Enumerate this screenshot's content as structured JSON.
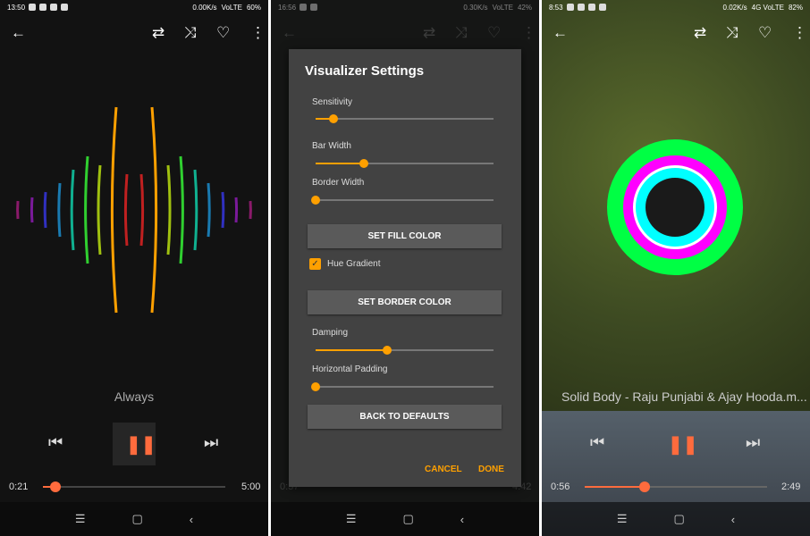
{
  "panels": [
    {
      "status": {
        "time": "13:50",
        "speed": "0.00K/s",
        "network": "VoLTE",
        "battery": "60%"
      },
      "track_title": "Always",
      "elapsed": "0:21",
      "duration": "5:00",
      "progress": 0.07
    },
    {
      "status": {
        "time": "16:56",
        "speed": "0.30K/s",
        "network": "VoLTE",
        "battery": "42%"
      },
      "elapsed": "0:37",
      "duration": "4:42",
      "dialog": {
        "title": "Visualizer Settings",
        "sliders": [
          {
            "label": "Sensitivity",
            "value": 0.1
          },
          {
            "label": "Bar Width",
            "value": 0.27
          },
          {
            "label": "Border Width",
            "value": 0
          },
          {
            "label": "Damping",
            "value": 0.4
          },
          {
            "label": "Horizontal Padding",
            "value": 0
          }
        ],
        "set_fill_color": "SET FILL COLOR",
        "hue_gradient": {
          "label": "Hue Gradient",
          "checked": true
        },
        "set_border_color": "SET BORDER COLOR",
        "back_to_defaults": "BACK TO DEFAULTS",
        "cancel": "CANCEL",
        "done": "DONE"
      }
    },
    {
      "status": {
        "time": "8:53",
        "speed": "0.02K/s",
        "network": "4G VoLTE",
        "battery": "82%"
      },
      "track_title": "Solid Body - Raju Punjabi & Ajay Hooda.m...",
      "elapsed": "0:56",
      "duration": "2:49",
      "progress": 0.36
    }
  ],
  "icons": {
    "back": "arrow-left-icon",
    "repeat": "repeat-icon",
    "shuffle": "shuffle-icon",
    "favorite": "heart-icon",
    "more": "more-vert-icon"
  },
  "colors": {
    "accent": "#ffa000",
    "seek": "#ff6b3d",
    "dialog_bg": "#424242",
    "visualizer_rings": [
      "#00ff44",
      "#ff00ff",
      "#ffffff",
      "#00ffff",
      "#1a1a1a"
    ]
  }
}
